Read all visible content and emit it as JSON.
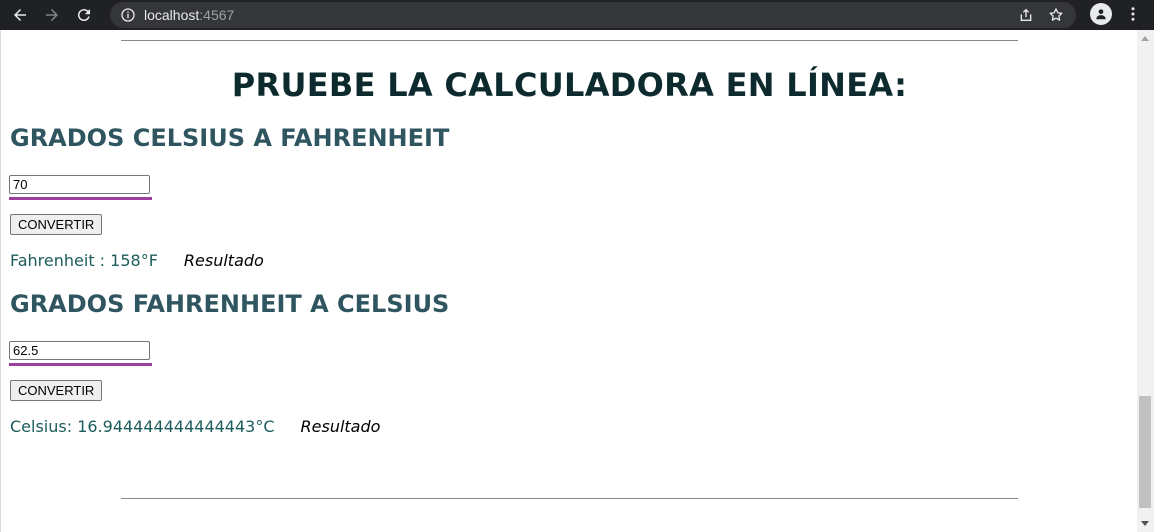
{
  "browser": {
    "url_host": "localhost",
    "url_port": ":4567",
    "icons": [
      "back-icon",
      "forward-icon",
      "reload-icon",
      "site-info-icon",
      "share-icon",
      "bookmark-star-icon",
      "profile-icon",
      "menu-icon"
    ]
  },
  "page": {
    "title": "PRUEBE LA CALCULADORA EN LÍNEA:"
  },
  "celsius_to_fahrenheit": {
    "heading": "GRADOS CELSIUS A FAHRENHEIT",
    "input_value": "70",
    "button_label": "CONVERTIR",
    "result_text": "Fahrenheit : 158°F",
    "result_tag": "Resultado"
  },
  "fahrenheit_to_celsius": {
    "heading": "GRADOS FAHRENHEIT A CELSIUS",
    "input_value": "62.5",
    "button_label": "CONVERTIR",
    "result_text": "Celsius: 16.944444444444443°C",
    "result_tag": "Resultado"
  },
  "colors": {
    "title": "#0d2a2e",
    "heading": "#2f5660",
    "result": "#1d5c5c",
    "input_accent": "#9b3f9b"
  }
}
